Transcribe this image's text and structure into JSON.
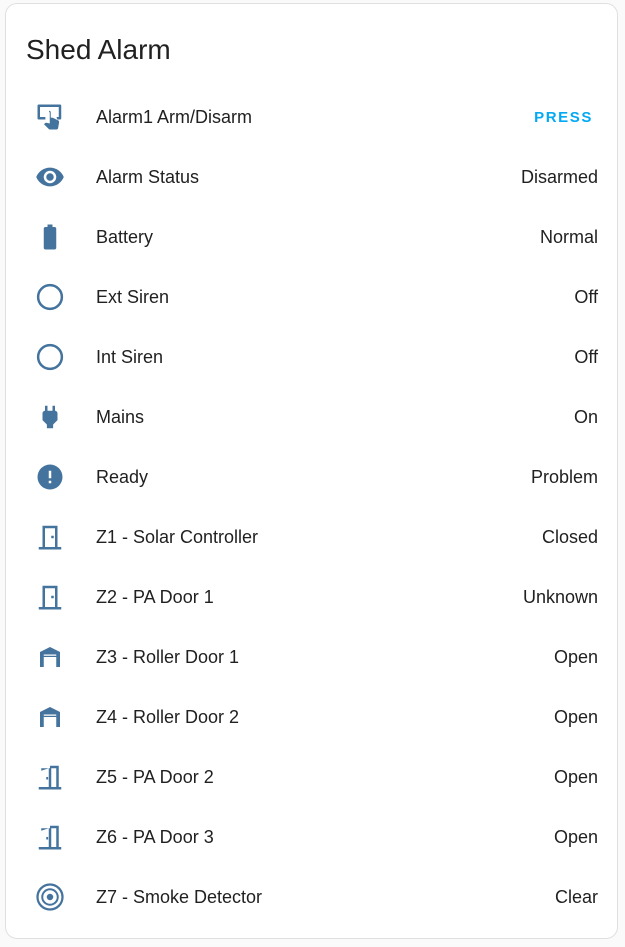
{
  "colors": {
    "icon": "#44739e",
    "accent": "#03a9f4",
    "text": "#212121"
  },
  "card": {
    "title": "Shed Alarm"
  },
  "rows": [
    {
      "name": "Alarm1 Arm/Disarm",
      "action_label": "PRESS",
      "icon": "gesture-tap-icon"
    },
    {
      "name": "Alarm Status",
      "state": "Disarmed",
      "icon": "eye-icon"
    },
    {
      "name": "Battery",
      "state": "Normal",
      "icon": "battery-icon"
    },
    {
      "name": "Ext Siren",
      "state": "Off",
      "icon": "circle-outline-icon"
    },
    {
      "name": "Int Siren",
      "state": "Off",
      "icon": "circle-outline-icon"
    },
    {
      "name": "Mains",
      "state": "On",
      "icon": "power-plug-icon"
    },
    {
      "name": "Ready",
      "state": "Problem",
      "icon": "alert-circle-icon"
    },
    {
      "name": "Z1 - Solar Controller",
      "state": "Closed",
      "icon": "door-closed-icon"
    },
    {
      "name": "Z2 - PA Door 1",
      "state": "Unknown",
      "icon": "door-closed-icon"
    },
    {
      "name": "Z3 - Roller Door 1",
      "state": "Open",
      "icon": "garage-open-icon"
    },
    {
      "name": "Z4 - Roller Door 2",
      "state": "Open",
      "icon": "garage-open-icon"
    },
    {
      "name": "Z5 - PA Door 2",
      "state": "Open",
      "icon": "door-open-icon"
    },
    {
      "name": "Z6 - PA Door 3",
      "state": "Open",
      "icon": "door-open-icon"
    },
    {
      "name": "Z7 - Smoke Detector",
      "state": "Clear",
      "icon": "smoke-detector-icon"
    }
  ]
}
